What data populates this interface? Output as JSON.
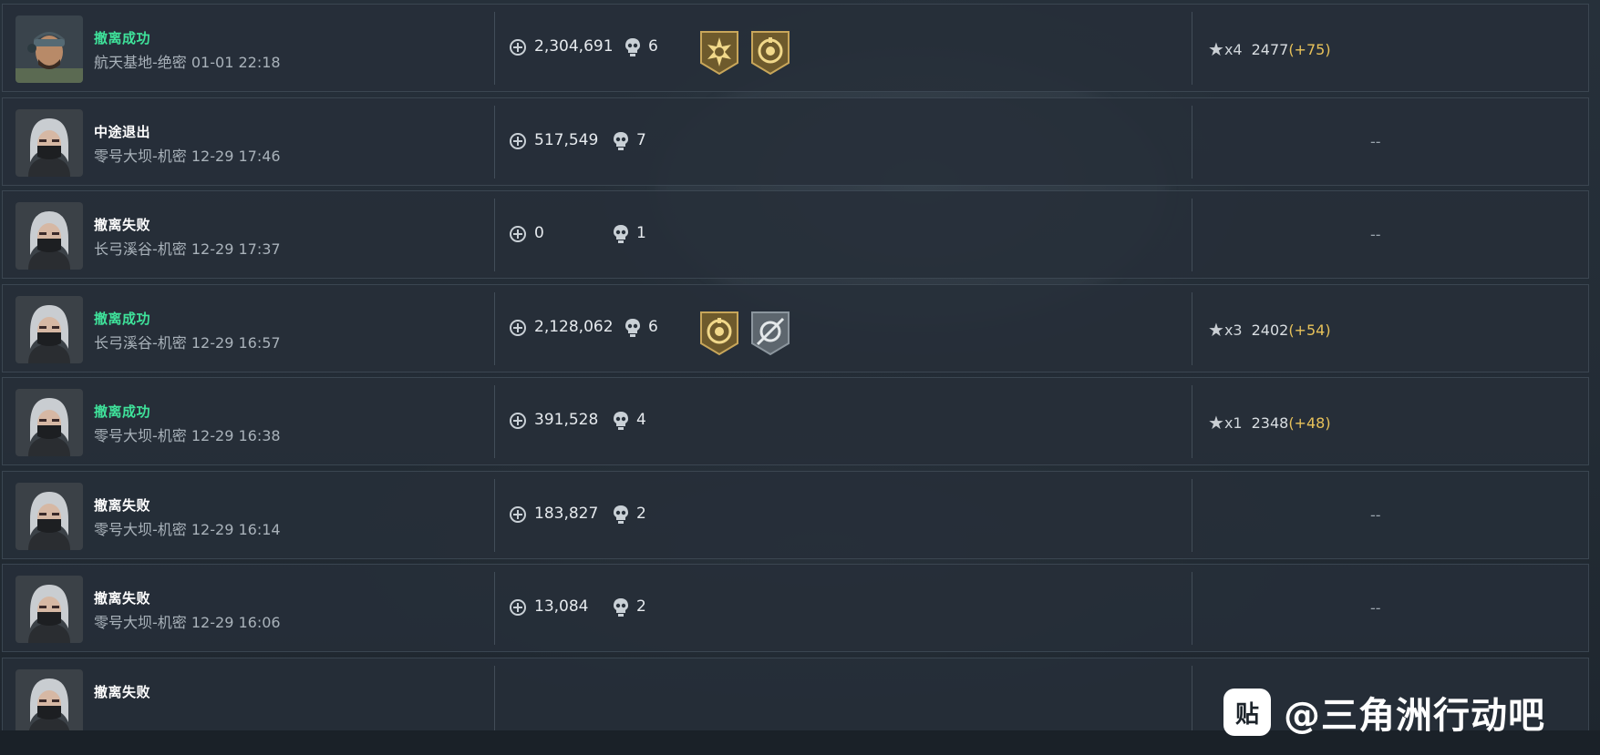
{
  "records": [
    {
      "avatar": "soldier-cap-avatar",
      "status": "撤离成功",
      "success": true,
      "map": "航天基地-绝密",
      "time": "01-01 22:18",
      "value": "2,304,691",
      "kills": "6",
      "badges": [
        "sun-burst-badge",
        "crest-badge"
      ],
      "stars": "x4",
      "score": "2477",
      "delta": "(+75)"
    },
    {
      "avatar": "masked-girl-avatar",
      "status": "中途退出",
      "success": false,
      "map": "零号大坝-机密",
      "time": "12-29 17:46",
      "value": "517,549",
      "kills": "7",
      "badges": [],
      "rank_text": "--"
    },
    {
      "avatar": "masked-girl-avatar",
      "status": "撤离失败",
      "success": false,
      "map": "长弓溪谷-机密",
      "time": "12-29 17:37",
      "value": "0",
      "kills": "1",
      "badges": [],
      "rank_text": "--"
    },
    {
      "avatar": "masked-girl-avatar",
      "status": "撤离成功",
      "success": true,
      "map": "长弓溪谷-机密",
      "time": "12-29 16:57",
      "value": "2,128,062",
      "kills": "6",
      "badges": [
        "crest-badge",
        "crosshair-badge"
      ],
      "stars": "x3",
      "score": "2402",
      "delta": "(+54)"
    },
    {
      "avatar": "masked-girl-avatar",
      "status": "撤离成功",
      "success": true,
      "map": "零号大坝-机密",
      "time": "12-29 16:38",
      "value": "391,528",
      "kills": "4",
      "badges": [],
      "stars": "x1",
      "score": "2348",
      "delta": "(+48)"
    },
    {
      "avatar": "masked-girl-avatar",
      "status": "撤离失败",
      "success": false,
      "map": "零号大坝-机密",
      "time": "12-29 16:14",
      "value": "183,827",
      "kills": "2",
      "badges": [],
      "rank_text": "--"
    },
    {
      "avatar": "masked-girl-avatar",
      "status": "撤离失败",
      "success": false,
      "map": "零号大坝-机密",
      "time": "12-29 16:06",
      "value": "13,084",
      "kills": "2",
      "badges": [],
      "rank_text": "--"
    },
    {
      "avatar": "masked-girl-avatar",
      "status": "撤离失败",
      "success": false,
      "map": "",
      "time": "",
      "value": "",
      "kills": "",
      "badges": [],
      "rank_text": ""
    }
  ],
  "icons": {
    "value": "coin-plus-icon",
    "kills": "skull-icon",
    "star": "star-icon"
  },
  "colors": {
    "success": "#3fe39b",
    "delta": "#e8c25a",
    "row_bg": "#262f39"
  },
  "watermark": {
    "logo": "贴",
    "text": "@三角洲行动吧"
  }
}
